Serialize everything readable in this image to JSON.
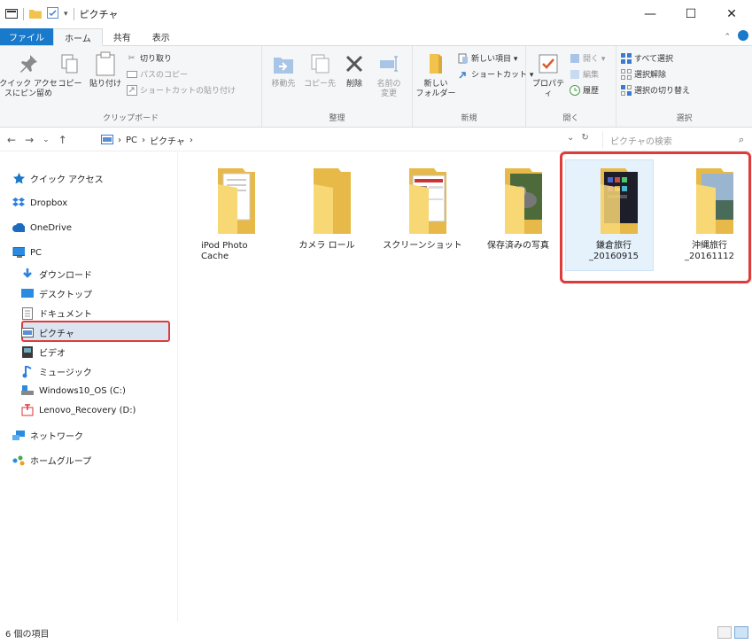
{
  "window": {
    "title": "ピクチャ",
    "controls": {
      "minimize": "—",
      "maximize": "☐",
      "close": "✕"
    }
  },
  "ribbon_tabs": [
    {
      "label": "ファイル"
    },
    {
      "label": "ホーム"
    },
    {
      "label": "共有"
    },
    {
      "label": "表示"
    }
  ],
  "ribbon": {
    "clipboard": {
      "pin": "クイック アクセ\nスにピン留め",
      "copy": "コピー",
      "paste": "貼り付け",
      "cut": "切り取り",
      "copy_path": "パスのコピー",
      "paste_shortcut": "ショートカットの貼り付け",
      "label": "クリップボード"
    },
    "organize": {
      "move_to": "移動先",
      "copy_to": "コピー先",
      "delete": "削除",
      "rename": "名前の\n変更",
      "label": "整理"
    },
    "new": {
      "new_folder": "新しい\nフォルダー",
      "new_item": "新しい項目 ▾",
      "shortcut": "ショートカット ▾",
      "label": "新規"
    },
    "open": {
      "properties": "プロパティ",
      "open": "開く ▾",
      "edit": "編集",
      "history": "履歴",
      "label": "開く"
    },
    "select": {
      "select_all": "すべて選択",
      "select_none": "選択解除",
      "invert": "選択の切り替え",
      "label": "選択"
    }
  },
  "addressbar": {
    "path": [
      "PC",
      "ピクチャ"
    ],
    "search_placeholder": "ピクチャの検索"
  },
  "navpane": {
    "items": [
      {
        "label": "クイック アクセス",
        "icon": "star-icon"
      },
      {
        "label": "Dropbox",
        "icon": "dropbox-icon"
      },
      {
        "label": "OneDrive",
        "icon": "cloud-icon"
      },
      {
        "label": "PC",
        "icon": "pc-icon"
      },
      {
        "label": "ダウンロード",
        "icon": "download-icon"
      },
      {
        "label": "デスクトップ",
        "icon": "desktop-icon"
      },
      {
        "label": "ドキュメント",
        "icon": "document-icon"
      },
      {
        "label": "ピクチャ",
        "icon": "pictures-icon"
      },
      {
        "label": "ビデオ",
        "icon": "video-icon"
      },
      {
        "label": "ミュージック",
        "icon": "music-icon"
      },
      {
        "label": "Windows10_OS (C:)",
        "icon": "drive-icon"
      },
      {
        "label": "Lenovo_Recovery (D:)",
        "icon": "recovery-drive-icon"
      },
      {
        "label": "ネットワーク",
        "icon": "network-icon"
      },
      {
        "label": "ホームグループ",
        "icon": "homegroup-icon"
      }
    ]
  },
  "folders": [
    {
      "name": "iPod Photo\nCache",
      "thumb": "documents"
    },
    {
      "name": "カメラ ロール",
      "thumb": "empty"
    },
    {
      "name": "スクリーンショット",
      "thumb": "screenshot"
    },
    {
      "name": "保存済みの写真",
      "thumb": "photo"
    },
    {
      "name": "鎌倉旅行\n_20160915",
      "thumb": "dark-photos"
    },
    {
      "name": "沖縄旅行\n_20161112",
      "thumb": "landscape"
    }
  ],
  "status": {
    "count": "6 個の項目"
  },
  "colors": {
    "accent": "#1979ca",
    "highlight": "#e03b3b",
    "folder": "#f8d775",
    "selection": "#dbe5f1"
  }
}
